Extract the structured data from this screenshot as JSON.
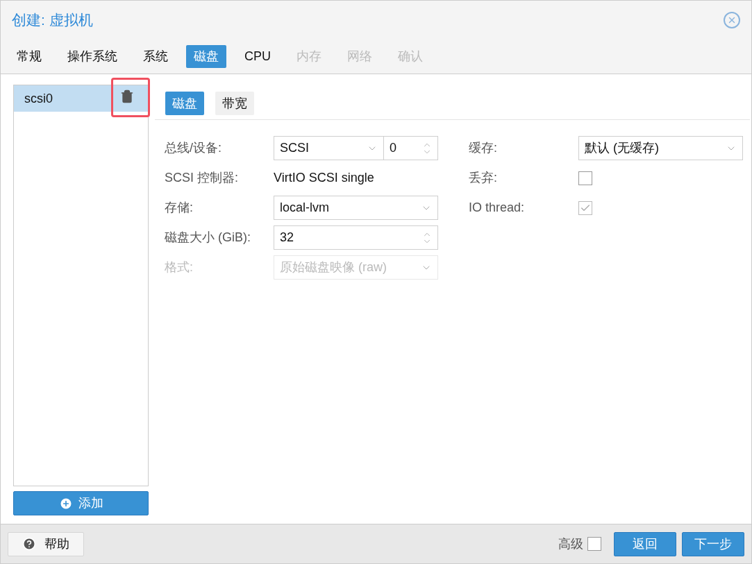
{
  "window": {
    "title": "创建: 虚拟机"
  },
  "tabs": [
    {
      "label": "常规",
      "selected": false,
      "disabled": false
    },
    {
      "label": "操作系统",
      "selected": false,
      "disabled": false
    },
    {
      "label": "系统",
      "selected": false,
      "disabled": false
    },
    {
      "label": "磁盘",
      "selected": true,
      "disabled": false
    },
    {
      "label": "CPU",
      "selected": false,
      "disabled": false
    },
    {
      "label": "内存",
      "selected": false,
      "disabled": true
    },
    {
      "label": "网络",
      "selected": false,
      "disabled": true
    },
    {
      "label": "确认",
      "selected": false,
      "disabled": true
    }
  ],
  "disk_list": {
    "items": [
      {
        "label": "scsi0",
        "selected": true,
        "highlighted": true
      }
    ],
    "add_button": "添加"
  },
  "subtabs": [
    {
      "label": "磁盘",
      "selected": true
    },
    {
      "label": "带宽",
      "selected": false
    }
  ],
  "left_fields": [
    {
      "kind": "combo_spin",
      "label": "总线/设备:",
      "value": "SCSI",
      "spin_value": "0",
      "disabled": false
    },
    {
      "kind": "text",
      "label": "SCSI 控制器:",
      "value": "VirtIO SCSI single",
      "disabled": false
    },
    {
      "kind": "combo",
      "label": "存储:",
      "value": "local-lvm",
      "disabled": false
    },
    {
      "kind": "spin",
      "label": "磁盘大小 (GiB):",
      "value": "32",
      "disabled": false
    },
    {
      "kind": "combo",
      "label": "格式:",
      "value": "原始磁盘映像 (raw)",
      "disabled": true
    }
  ],
  "right_fields": [
    {
      "kind": "combo",
      "label": "缓存:",
      "value": "默认 (无缓存)",
      "disabled": false
    },
    {
      "kind": "checkbox",
      "label": "丢弃:",
      "checked": false,
      "disabled": false
    },
    {
      "kind": "checkbox",
      "label": "IO thread:",
      "checked": true,
      "disabled": true
    }
  ],
  "footer": {
    "help_button": "帮助",
    "advanced": {
      "label": "高级",
      "checked": false
    },
    "buttons": [
      "返回",
      "下一步"
    ]
  }
}
